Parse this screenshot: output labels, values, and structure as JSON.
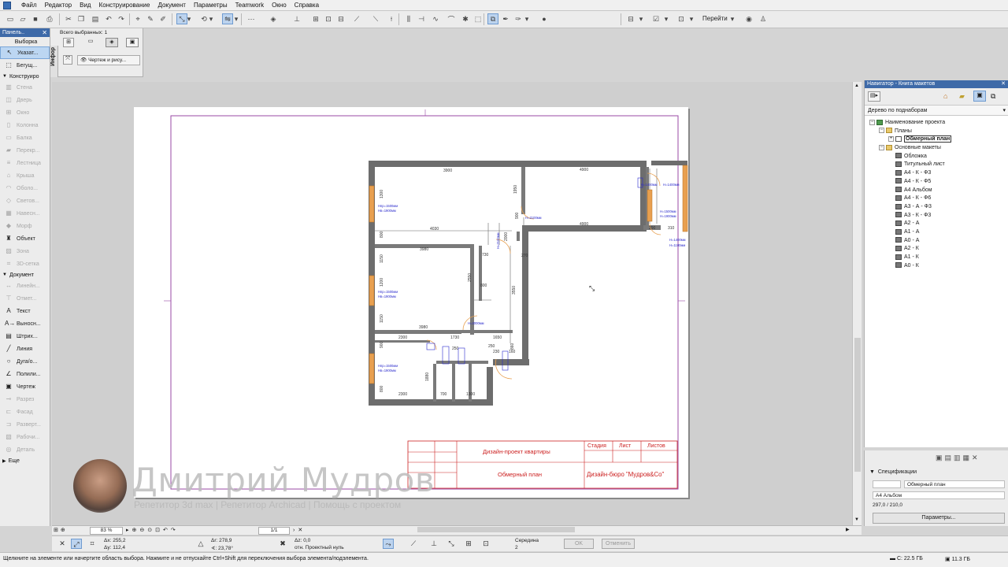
{
  "menu": [
    "Файл",
    "Редактор",
    "Вид",
    "Конструирование",
    "Документ",
    "Параметры",
    "Teamwork",
    "Окно",
    "Справка"
  ],
  "toolbar": {
    "goto_label": "Перейти"
  },
  "toolbox": {
    "title": "Панель..",
    "sections": {
      "select": "Выборка",
      "construct": "Конструиро",
      "document": "Документ",
      "more": "Еще"
    },
    "select_tools": [
      {
        "label": "Указат...",
        "icon": "arrow-pointer-icon",
        "state": "selected"
      },
      {
        "label": "Бегущ...",
        "icon": "marquee-icon",
        "state": "enabled"
      }
    ],
    "construct_tools": [
      {
        "label": "Стена",
        "icon": "wall-icon",
        "state": "disabled"
      },
      {
        "label": "Дверь",
        "icon": "door-icon",
        "state": "disabled"
      },
      {
        "label": "Окно",
        "icon": "window-icon",
        "state": "disabled"
      },
      {
        "label": "Колонна",
        "icon": "column-icon",
        "state": "disabled"
      },
      {
        "label": "Балка",
        "icon": "beam-icon",
        "state": "disabled"
      },
      {
        "label": "Перекр...",
        "icon": "slab-icon",
        "state": "disabled"
      },
      {
        "label": "Лестница",
        "icon": "stair-icon",
        "state": "disabled"
      },
      {
        "label": "Крыша",
        "icon": "roof-icon",
        "state": "disabled"
      },
      {
        "label": "Оболо...",
        "icon": "shell-icon",
        "state": "disabled"
      },
      {
        "label": "Светов...",
        "icon": "skylight-icon",
        "state": "disabled"
      },
      {
        "label": "Навесн...",
        "icon": "curtain-wall-icon",
        "state": "disabled"
      },
      {
        "label": "Морф",
        "icon": "morph-icon",
        "state": "disabled"
      },
      {
        "label": "Объект",
        "icon": "object-icon",
        "state": "enabled"
      },
      {
        "label": "Зона",
        "icon": "zone-icon",
        "state": "disabled"
      },
      {
        "label": "3D-сетка",
        "icon": "mesh-icon",
        "state": "disabled"
      }
    ],
    "document_tools": [
      {
        "label": "Линейн...",
        "icon": "dimension-icon",
        "state": "disabled"
      },
      {
        "label": "Отмет...",
        "icon": "level-icon",
        "state": "disabled"
      },
      {
        "label": "Текст",
        "icon": "text-icon",
        "state": "enabled"
      },
      {
        "label": "Выносн...",
        "icon": "label-icon",
        "state": "enabled"
      },
      {
        "label": "Штрих...",
        "icon": "fill-icon",
        "state": "enabled"
      },
      {
        "label": "Линия",
        "icon": "line-icon",
        "state": "enabled"
      },
      {
        "label": "Дуга/о...",
        "icon": "arc-icon",
        "state": "enabled"
      },
      {
        "label": "Полили...",
        "icon": "polyline-icon",
        "state": "enabled"
      },
      {
        "label": "Чертеж",
        "icon": "drawing-icon",
        "state": "enabled"
      },
      {
        "label": "Разрез",
        "icon": "section-icon",
        "state": "disabled"
      },
      {
        "label": "Фасад",
        "icon": "elevation-icon",
        "state": "disabled"
      },
      {
        "label": "Разверт...",
        "icon": "interior-icon",
        "state": "disabled"
      },
      {
        "label": "Рабочи...",
        "icon": "worksheet-icon",
        "state": "disabled"
      },
      {
        "label": "Деталь",
        "icon": "detail-icon",
        "state": "disabled"
      }
    ]
  },
  "infobox": {
    "selected_count": "Всего выбранных: 1",
    "tab": "Инфор",
    "drawing_label": "Чертеж и рису..."
  },
  "drawing": {
    "dims": {
      "d3900a": "3900",
      "d4900a": "4900",
      "d4030": "4030",
      "d4900b": "4900",
      "d3980": "3980",
      "d730": "730",
      "d1950": "1950",
      "d2000a": "2000",
      "d900a": "900",
      "d1300a": "1300",
      "d800a": "800",
      "d1150a": "1150",
      "d1200": "1200",
      "d1150b": "1150",
      "d2550": "2550",
      "d800b": "800",
      "d3550": "3550",
      "d3980b": "3980",
      "d1650": "1650",
      "d2300a": "2300",
      "d1730": "1730",
      "d250a": "250",
      "d900b": "900",
      "d800c": "800",
      "d2300b": "2300",
      "d700": "700",
      "d1300b": "1300",
      "d1880": "1880",
      "d290": "290",
      "d310": "310",
      "d270": "270",
      "d860": "860",
      "d230": "230",
      "d160": "160",
      "d250b": "250"
    },
    "window_notes": [
      "Нпр=1500мм",
      "Нпр=1500мм",
      "Нпр=1500мм"
    ],
    "window_notes_b": [
      "Нв=1900мм",
      "Нв=1900мм",
      "Нв=1900мм"
    ],
    "door_notes": [
      "Н=2100мм",
      "Н=2100мм",
      "Н=2000мм",
      "Н=1400мм",
      "Н=1400мм",
      "Н=1500мм",
      "Н=1900мм",
      "Н=1400мм",
      "Н=1100мм"
    ]
  },
  "title_block": {
    "project": "Дизайн-проект квартиры",
    "drawing": "Обмерный план",
    "stage": "Стадия",
    "sheet": "Лист",
    "sheets": "Листов",
    "company": "Дизайн-бюро \"Мудров&Co\""
  },
  "watermark": {
    "name": "Дмитрий Мудров",
    "subtitle": "Репетитор 3d max | Репетитор Archicad | Помощь с проектом"
  },
  "navigator": {
    "title": "Навигатор - Книга макетов",
    "view_mode": "Дерево по поднаборам",
    "tree": [
      {
        "label": "Наименование проекта",
        "icon": "project",
        "indent": 0,
        "exp": "−"
      },
      {
        "label": "Планы",
        "icon": "folder",
        "indent": 1,
        "exp": "−"
      },
      {
        "label": "Обмерный план",
        "icon": "plan",
        "indent": 2,
        "exp": "+",
        "bold": true
      },
      {
        "label": "Основные макеты",
        "icon": "folder",
        "indent": 1,
        "exp": "−"
      },
      {
        "label": "Обложка",
        "icon": "layout",
        "indent": 2
      },
      {
        "label": "Титульный лист",
        "icon": "layout",
        "indent": 2
      },
      {
        "label": "А4 - К - Ф3",
        "icon": "layout",
        "indent": 2
      },
      {
        "label": "А4 - К - Ф5",
        "icon": "layout",
        "indent": 2
      },
      {
        "label": "А4 Альбом",
        "icon": "layout",
        "indent": 2
      },
      {
        "label": "А4 - К - Ф6",
        "icon": "layout",
        "indent": 2
      },
      {
        "label": "А3 - А - Ф3",
        "icon": "layout",
        "indent": 2
      },
      {
        "label": "А3 - К - Ф3",
        "icon": "layout",
        "indent": 2
      },
      {
        "label": "А2 - А",
        "icon": "layout",
        "indent": 2
      },
      {
        "label": "А1 - А",
        "icon": "layout",
        "indent": 2
      },
      {
        "label": "А0 - А",
        "icon": "layout",
        "indent": 2
      },
      {
        "label": "А2 - К",
        "icon": "layout",
        "indent": 2
      },
      {
        "label": "А1 - К",
        "icon": "layout",
        "indent": 2
      },
      {
        "label": "А0 - К",
        "icon": "layout",
        "indent": 2
      }
    ]
  },
  "specs": {
    "title": "Спецификации",
    "name_value": "Обмерный план",
    "layout_value": "А4 Альбом",
    "size_value": "297,0 / 210,0",
    "params_button": "Параметры..."
  },
  "navstrip": {
    "zoom": "83 %",
    "page": "1/1"
  },
  "coords": {
    "dx": "Δx: 255,2",
    "dy": "Δy: 112,4",
    "r": "Δr: 278,9",
    "a": "∢: 23,78°",
    "z": "Δz: 0,0",
    "ref": "отн. Проектный нуль",
    "snap": "Середина",
    "snap_count": "2",
    "ok": "OK",
    "cancel": "Отменить"
  },
  "status": {
    "message": "Щелкните на элементе или начертите область выбора. Нажмите и не отпускайте Ctrl+Shift для переключения выбора элемента/подэлемента.",
    "disk_c": "C: 22.5 ГБ",
    "disk_mem": "11.3 ГБ"
  },
  "colors": {
    "title_bar": "#3e6aa8",
    "plan_wall": "#6d6d6d",
    "window_orange": "#e8a050",
    "dimension_blue": "#2a2acc",
    "title_block_red": "#cc2222",
    "frame_purple": "#9a4aa6"
  }
}
